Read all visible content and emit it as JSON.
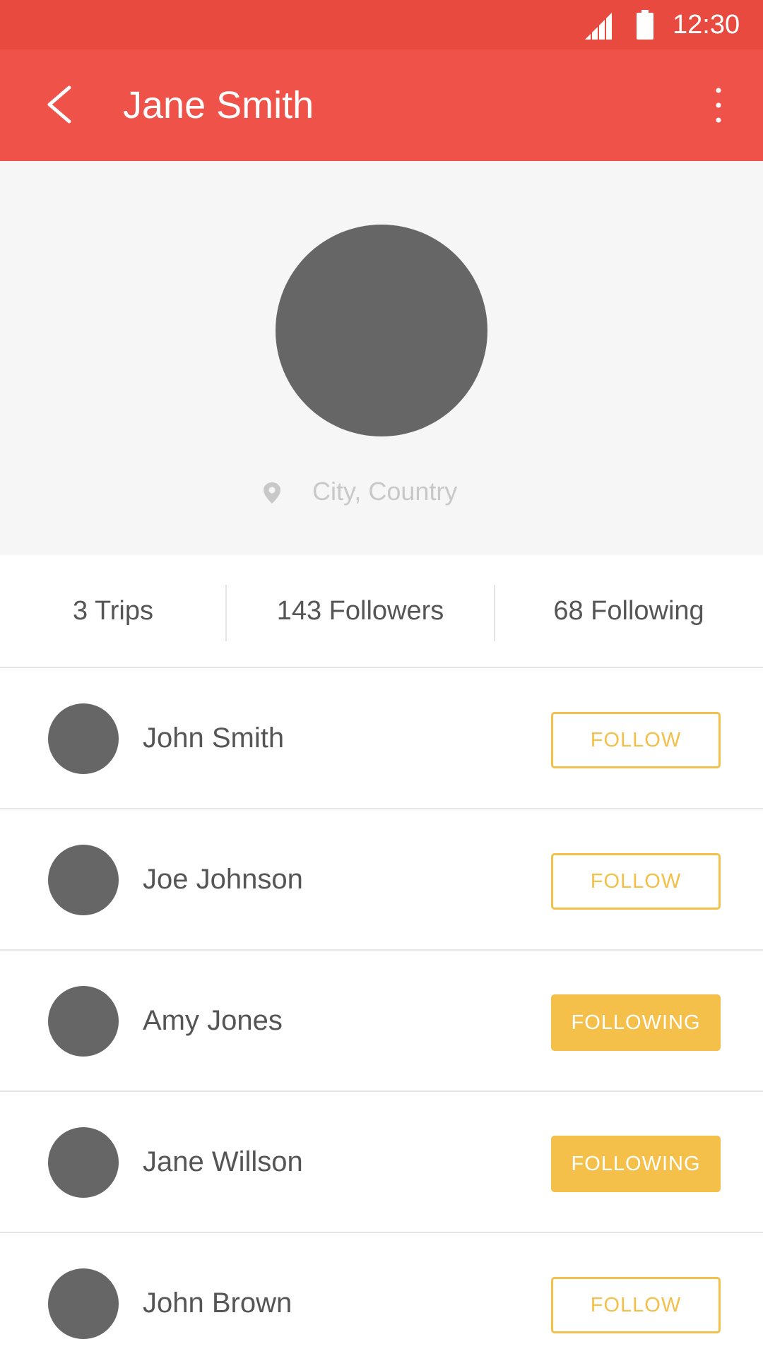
{
  "status_bar": {
    "time": "12:30",
    "icons": [
      "signal-icon",
      "battery-icon"
    ]
  },
  "app_bar": {
    "title": "Jane Smith",
    "back_icon": "chevron-left-icon",
    "menu_icon": "more-vertical-icon"
  },
  "profile": {
    "location": "City, Country",
    "location_icon": "location-pin-icon"
  },
  "stats": {
    "trips": "3 Trips",
    "followers": "143 Followers",
    "following": "68 Following"
  },
  "users": [
    {
      "name": "John Smith",
      "action": "FOLLOW",
      "state": "follow"
    },
    {
      "name": "Joe Johnson",
      "action": "FOLLOW",
      "state": "follow"
    },
    {
      "name": "Amy Jones",
      "action": "FOLLOWING",
      "state": "following"
    },
    {
      "name": "Jane Willson",
      "action": "FOLLOWING",
      "state": "following"
    },
    {
      "name": "John Brown",
      "action": "FOLLOW",
      "state": "follow"
    }
  ],
  "colors": {
    "status_bar": "#e84a40",
    "app_bar": "#ef5249",
    "accent": "#f5c04a",
    "avatar": "#666666",
    "header_bg": "#f6f6f6"
  }
}
